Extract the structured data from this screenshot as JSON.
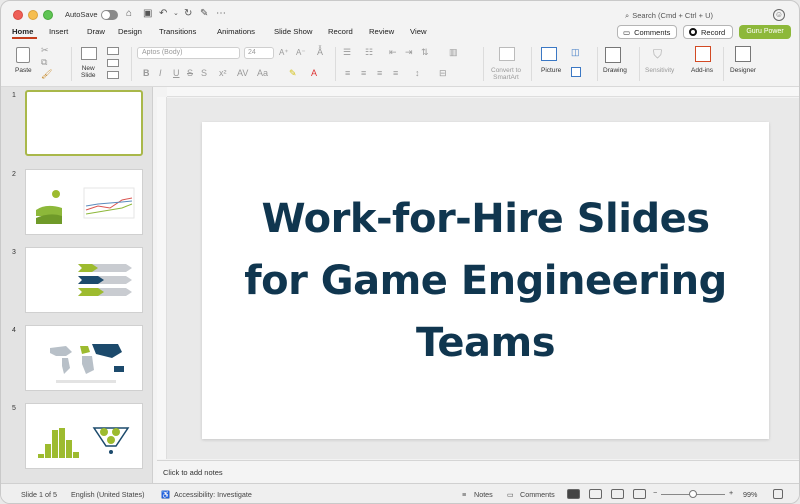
{
  "titlebar": {
    "autosave_label": "AutoSave",
    "search_label": "Search (Cmd + Ctrl + U)"
  },
  "tabs": [
    "Home",
    "Insert",
    "Draw",
    "Design",
    "Transitions",
    "Animations",
    "Slide Show",
    "Record",
    "Review",
    "View"
  ],
  "active_tab": "Home",
  "header_buttons": {
    "comments": "Comments",
    "record": "Record",
    "guru": "Guru Power"
  },
  "ribbon": {
    "paste": "Paste",
    "new_slide_line1": "New",
    "new_slide_line2": "Slide",
    "font_name": "Aptos (Body)",
    "font_size": "24",
    "convert_line1": "Convert to",
    "convert_line2": "SmartArt",
    "picture": "Picture",
    "drawing": "Drawing",
    "sensitivity": "Sensitivity",
    "addins": "Add-ins",
    "designer": "Designer"
  },
  "thumbnails": [
    {
      "number": "1",
      "selected": true
    },
    {
      "number": "2",
      "selected": false
    },
    {
      "number": "3",
      "selected": false
    },
    {
      "number": "4",
      "selected": false
    },
    {
      "number": "5",
      "selected": false
    }
  ],
  "slide": {
    "title_line1": "Work-for-Hire Slides",
    "title_line2": "for Game Engineering",
    "title_line3": "Teams",
    "title_color": "#10364f"
  },
  "notes_placeholder": "Click to add notes",
  "status": {
    "slide_counter": "Slide 1 of 5",
    "language": "English (United States)",
    "accessibility": "Accessibility: Investigate",
    "notes": "Notes",
    "comments": "Comments",
    "zoom": "99%"
  },
  "accent_color": "#c43e1c",
  "brand_green": "#8db83a"
}
